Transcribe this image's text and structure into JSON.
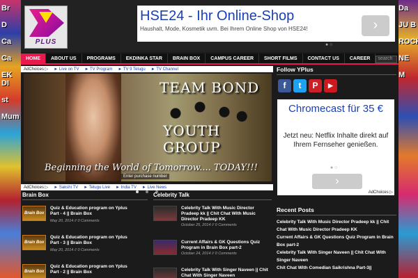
{
  "side_left": [
    "Br",
    "D",
    "Ca",
    "Ca",
    "EK DI",
    "st",
    "Mum"
  ],
  "side_right": [
    "Da",
    "JU B",
    "ROCK",
    "NE",
    "M"
  ],
  "logo": {
    "text": "PLUS"
  },
  "top_ad": {
    "title": "HSE24 - Ihr Online-Shop",
    "desc": "Haushalt, Mode, Kosmetik uvm. Bei Ihrem Online Shop von HSE24!",
    "arrow": "›",
    "dots": "● ○",
    "choices": "AdChoices ▷"
  },
  "nav": {
    "items": [
      "HOME",
      "ABOUT US",
      "PROGRAMS",
      "EKDINKA STAR",
      "BRAIN BOX",
      "CAMPUS CAREER",
      "SHORT FILMS",
      "CONTACT US",
      "CAREER"
    ],
    "search_placeholder": "search"
  },
  "ad_links_1": {
    "choices": "AdChoices ▷",
    "links": [
      "► Live on TV",
      "► TV Program",
      "► TV 9 Telugu",
      "► TV Channel"
    ]
  },
  "slider": {
    "title1": "TEAM BOND",
    "title2": "YOUTH GROUP",
    "tagline": "Beginning the World of Tomorrow.... TODAY!!!",
    "caption": "Enter purchase number"
  },
  "ad_links_2": {
    "choices": "AdChoices ▷",
    "links": [
      "► Sakshi TV",
      "► Telugu Live",
      "► India TV",
      "► Live News"
    ]
  },
  "brain_box": {
    "title": "Brain Box",
    "thumb_label": "Brain Box",
    "posts": [
      {
        "title": "Quiz & Education program on Yplus Part - 4 || Brain Box",
        "date": "May 20, 2014 // 0 Comments"
      },
      {
        "title": "Quiz & Education program on Yplus Part - 3 || Brain Box",
        "date": "May 20, 2014 // 0 Comments"
      },
      {
        "title": "Quiz & Education program on Yplus Part - 2 || Brain Box",
        "date": ""
      }
    ]
  },
  "celebrity_talk": {
    "title": "Celebrity Talk",
    "posts": [
      {
        "title": "Celebrity Talk With Music Director Pradeep kk || Chit Chat With Music Director Pradeep KK",
        "date": "October 25, 2014 // 0 Comments"
      },
      {
        "title": "Current Affairs & GK Questions Quiz Program in Brain Box part-2",
        "date": "October 24, 2014 // 0 Comments"
      },
      {
        "title": "Celebrity Talk With Singer Naveen || Chit Chat With Singer Naveen",
        "date": ""
      }
    ]
  },
  "sidebar": {
    "follow_title": "Follow YPlus",
    "social": [
      {
        "name": "facebook-icon",
        "glyph": "f",
        "color": "#3b5998"
      },
      {
        "name": "twitter-icon",
        "glyph": "t",
        "color": "#1da1f2"
      },
      {
        "name": "pinterest-icon",
        "glyph": "P",
        "color": "#cb2027"
      },
      {
        "name": "youtube-icon",
        "glyph": "▶",
        "color": "#cc181e"
      }
    ],
    "ad": {
      "headline": "Chromecast für 35 €",
      "body": "Jetzt neu: Netflix Inhalte direkt auf Ihrem Fernseher genießen.",
      "dots": "● ○",
      "arrow": "›",
      "choices": "AdChoices ▷"
    },
    "recent_title": "Recent Posts",
    "recent": [
      "Celebrity Talk With Music Director Pradeep kk || Chit Chat With Music Director Pradeep KK",
      "Current Affairs & GK Questions Quiz Program in Brain Box part-2",
      "Celebrity Talk With Singer Naveen || Chit Chat With Singer Naveen",
      "Chit Chat With Comedian Saikrishna Part-3||"
    ]
  },
  "colors": {
    "accent": "#e8194c",
    "link": "#1a3fb5",
    "bg": "#1b1b1b"
  }
}
